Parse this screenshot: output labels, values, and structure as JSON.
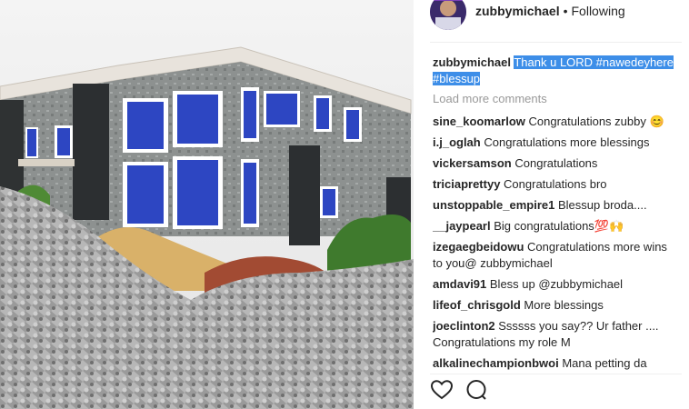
{
  "post": {
    "username": "zubbymichael",
    "separator": "•",
    "follow_status": "Following",
    "caption_user": "zubbymichael",
    "caption_text": "Thank u LORD #nawedeyhere #blessup",
    "load_more": "Load more comments"
  },
  "comments": [
    {
      "user": "sine_koomarlow",
      "text": "Congratulations zubby 😊"
    },
    {
      "user": "i.j_oglah",
      "text": "Congratulations more blessings"
    },
    {
      "user": "vickersamson",
      "text": "Congratulations"
    },
    {
      "user": "triciaprettyy",
      "text": "Congratulations bro"
    },
    {
      "user": "unstoppable_empire1",
      "text": "Blessup broda...."
    },
    {
      "user": "__jaypearl",
      "text": "Big congratulations💯🙌"
    },
    {
      "user": "izegaegbeidowu",
      "text": "Congratulations more wins to you@ zubbymichael"
    },
    {
      "user": "amdavi91",
      "text": "Bless up @zubbymichael"
    },
    {
      "user": "lifeof_chrisgold",
      "text": "More blessings"
    },
    {
      "user": "joeclinton2",
      "text": "Ssssss you say?? Ur father .... Congratulations my role M"
    },
    {
      "user": "alkalinechampionbwoi",
      "text": "Mana petting da"
    }
  ],
  "icons": {
    "like": "heart-icon",
    "comment": "comment-icon"
  },
  "colors": {
    "highlight": "#3d8ee8",
    "muted": "#999999",
    "text": "#262626"
  }
}
